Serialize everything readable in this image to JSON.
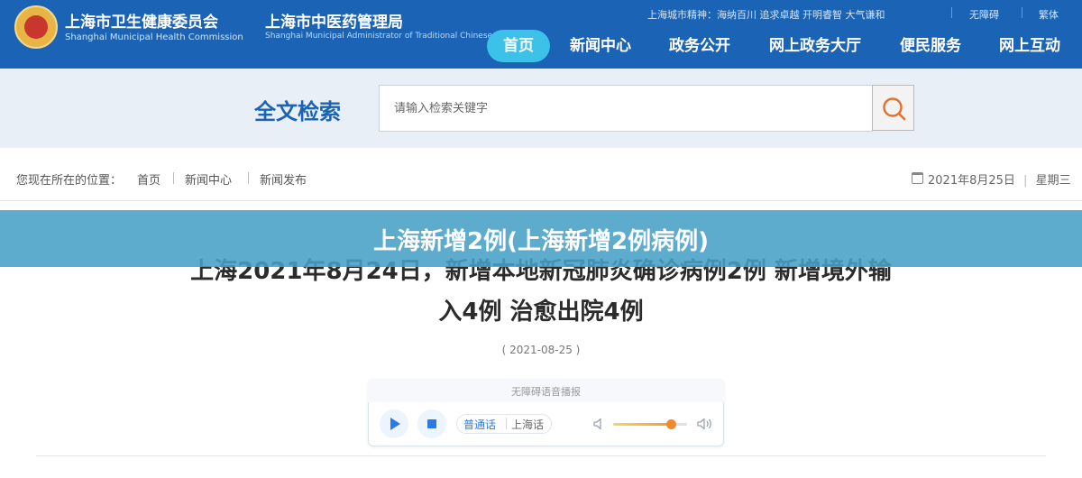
{
  "header": {
    "org1_name": "上海市卫生健康委员会",
    "org1_en": "Shanghai Municipal Health Commission",
    "org2_name": "上海市中医药管理局",
    "org2_en": "Shanghai Municipal Administrator of Traditional Chinese Medicine",
    "city_spirit": "上海城市精神：海纳百川 追求卓越 开明睿智 大气谦和",
    "accessibility": "无障碍",
    "traditional": "繁体",
    "nav": [
      {
        "label": "首页",
        "active": true
      },
      {
        "label": "新闻中心",
        "active": false
      },
      {
        "label": "政务公开",
        "active": false
      },
      {
        "label": "网上政务大厅",
        "active": false
      },
      {
        "label": "便民服务",
        "active": false
      },
      {
        "label": "网上互动",
        "active": false
      }
    ],
    "brand_color": "#1a63b5",
    "active_color": "#3cc1e8"
  },
  "search": {
    "title": "全文检索",
    "placeholder": "请输入检索关键字",
    "button_icon": "search-icon"
  },
  "breadcrumb": {
    "prefix": "您现在所在的位置：",
    "items": [
      "首页",
      "新闻中心",
      "新闻发布"
    ],
    "date": "2021年8月25日",
    "weekday": "星期三"
  },
  "overlay": {
    "text": "上海新增2例(上海新增2例病例)"
  },
  "article": {
    "headline_line1": "上海2021年8月24日，新增本地新冠肺炎确诊病例2例 新增境外输",
    "headline_line2": "入4例 治愈出院4例",
    "pubdate": "( 2021-08-25 )"
  },
  "player": {
    "caption": "无障碍语音播报",
    "lang_options": [
      "普通话",
      "上海话"
    ],
    "selected_lang": "普通话",
    "volume": 0.78,
    "icons": [
      "play-icon",
      "stop-icon",
      "volume-low-icon",
      "volume-high-icon"
    ]
  }
}
